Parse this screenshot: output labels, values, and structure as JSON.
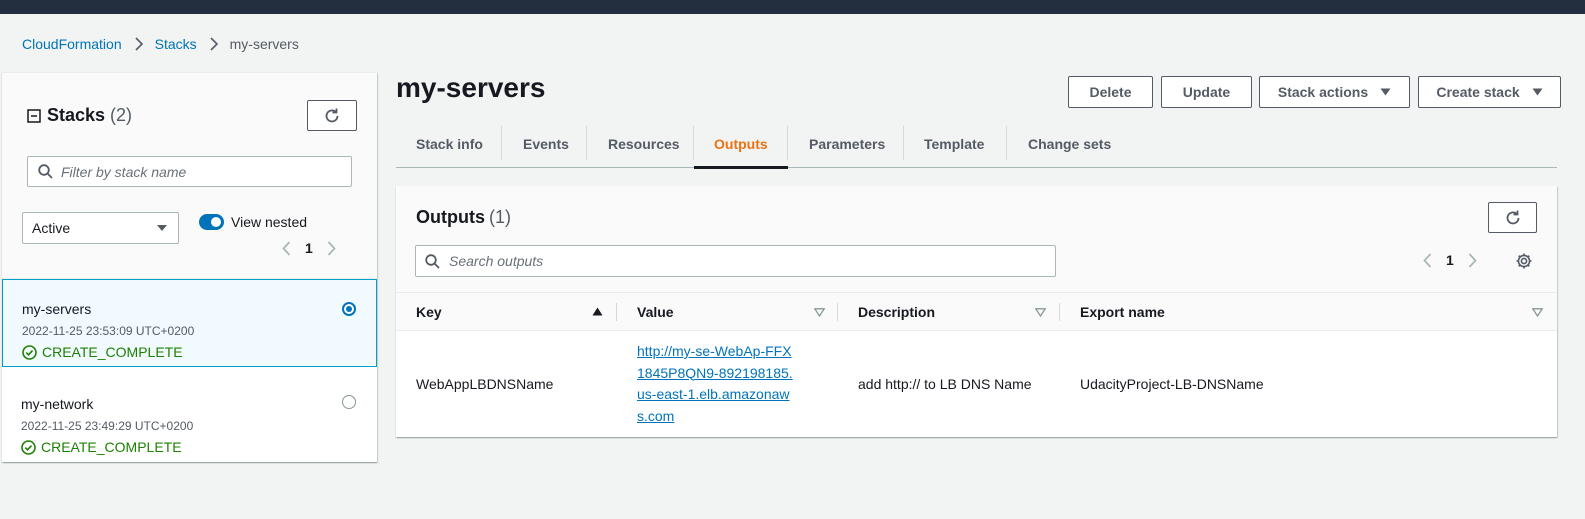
{
  "breadcrumb": {
    "items": [
      "CloudFormation",
      "Stacks"
    ],
    "current": "my-servers"
  },
  "sidebar": {
    "title": "Stacks",
    "count": "(2)",
    "filter_placeholder": "Filter by stack name",
    "status_filter": "Active",
    "view_nested_label": "View nested",
    "page": "1",
    "stacks": [
      {
        "name": "my-servers",
        "timestamp": "2022-11-25 23:53:09 UTC+0200",
        "status": "CREATE_COMPLETE",
        "selected": true
      },
      {
        "name": "my-network",
        "timestamp": "2022-11-25 23:49:29 UTC+0200",
        "status": "CREATE_COMPLETE",
        "selected": false
      }
    ]
  },
  "main": {
    "title": "my-servers",
    "buttons": {
      "delete": "Delete",
      "update": "Update",
      "stack_actions": "Stack actions",
      "create_stack": "Create stack"
    },
    "tabs": [
      "Stack info",
      "Events",
      "Resources",
      "Outputs",
      "Parameters",
      "Template",
      "Change sets"
    ],
    "active_tab": "Outputs"
  },
  "outputs": {
    "title": "Outputs",
    "count": "(1)",
    "search_placeholder": "Search outputs",
    "page": "1",
    "columns": [
      "Key",
      "Value",
      "Description",
      "Export name"
    ],
    "rows": [
      {
        "key": "WebAppLBDNSName",
        "value": "http://my-se-WebAp-FFX1845P8QN9-892198185.us-east-1.elb.amazonaws.com",
        "description": "add http:// to LB DNS Name",
        "export_name": "UdacityProject-LB-DNSName"
      }
    ]
  },
  "colors": {
    "header_bg": "#232f3e",
    "link": "#0073bb",
    "active_tab": "#ec7211",
    "success": "#1d8102",
    "selected_bg": "#f1faff"
  }
}
